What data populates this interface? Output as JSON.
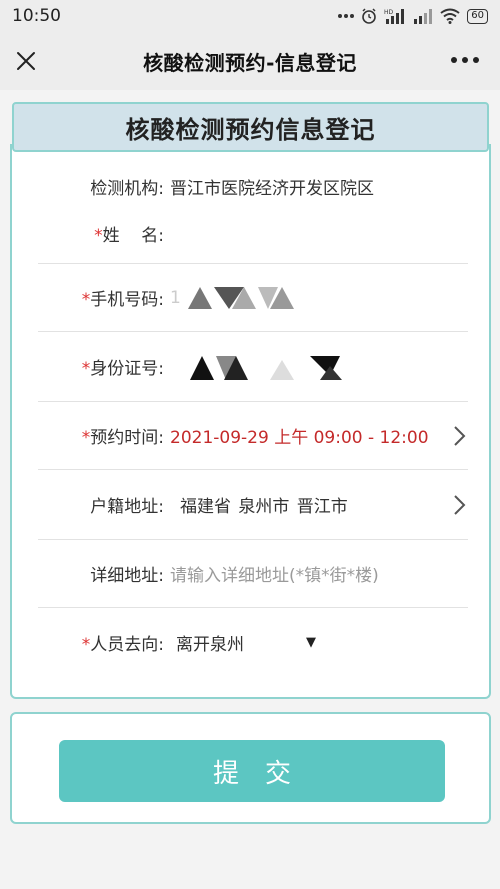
{
  "status": {
    "time": "10:50",
    "battery": "60",
    "hd_label": "HD"
  },
  "nav": {
    "title": "核酸检测预约-信息登记",
    "close_icon": "close-icon",
    "more_icon": "more-icon"
  },
  "header": {
    "title": "核酸检测预约信息登记"
  },
  "form": {
    "institution": {
      "label": "检测机构:",
      "value": "晋江市医院经济开发区院区"
    },
    "name": {
      "required": "*",
      "label": "姓    名:",
      "value": ""
    },
    "phone": {
      "required": "*",
      "label": "手机号码:",
      "value": "1"
    },
    "id_number": {
      "required": "*",
      "label": "身份证号:",
      "value": ""
    },
    "appointment": {
      "required": "*",
      "label": "预约时间:",
      "value": "2021-09-29 上午 09:00 - 12:00"
    },
    "household": {
      "label": "户籍地址:",
      "value": "福建省 泉州市 晋江市"
    },
    "address": {
      "label": "详细地址:",
      "placeholder": "请输入详细地址(*镇*街*楼)"
    },
    "destination": {
      "required": "*",
      "label": "人员去向:",
      "value": "离开泉州",
      "caret": "▼"
    }
  },
  "submit": {
    "label": "提交"
  },
  "colors": {
    "accent": "#5cc6c2",
    "border": "#8fd3cf",
    "header_bg": "#d1e2ea",
    "required": "#d33333",
    "appointment_text": "#c42a2a"
  }
}
